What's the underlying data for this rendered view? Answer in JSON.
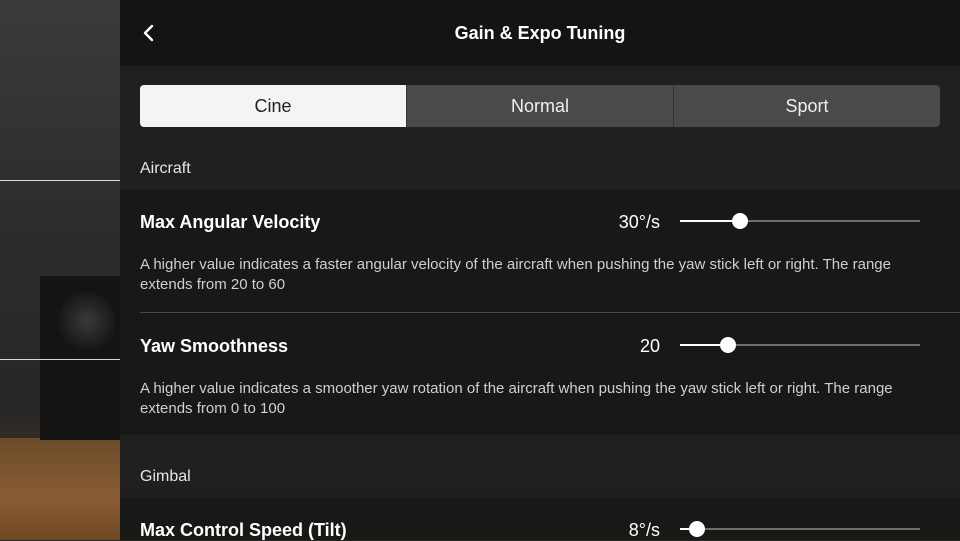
{
  "header": {
    "title": "Gain & Expo Tuning",
    "back_icon": "chevron-left-icon"
  },
  "modes": {
    "tabs": [
      "Cine",
      "Normal",
      "Sport"
    ],
    "selected": "Cine"
  },
  "sections": {
    "aircraft": {
      "label": "Aircraft",
      "items": [
        {
          "title": "Max Angular Velocity",
          "value": "30°/s",
          "level": 0.25,
          "description": "A higher value indicates a faster angular velocity of the aircraft when pushing the yaw stick left or right. The range extends from 20 to 60"
        },
        {
          "title": "Yaw Smoothness",
          "value": "20",
          "level": 0.2,
          "description": "A higher value indicates a smoother yaw rotation of the aircraft when pushing the yaw stick left or right. The range extends from 0 to 100"
        }
      ]
    },
    "gimbal": {
      "label": "Gimbal",
      "items": [
        {
          "title": "Max Control Speed (Tilt)",
          "value": "8°/s",
          "level": 0.07
        }
      ]
    }
  },
  "colors": {
    "accent": "#ffffff",
    "selected_tab_bg": "#f4f4f4",
    "track": "#6e6e6e"
  }
}
